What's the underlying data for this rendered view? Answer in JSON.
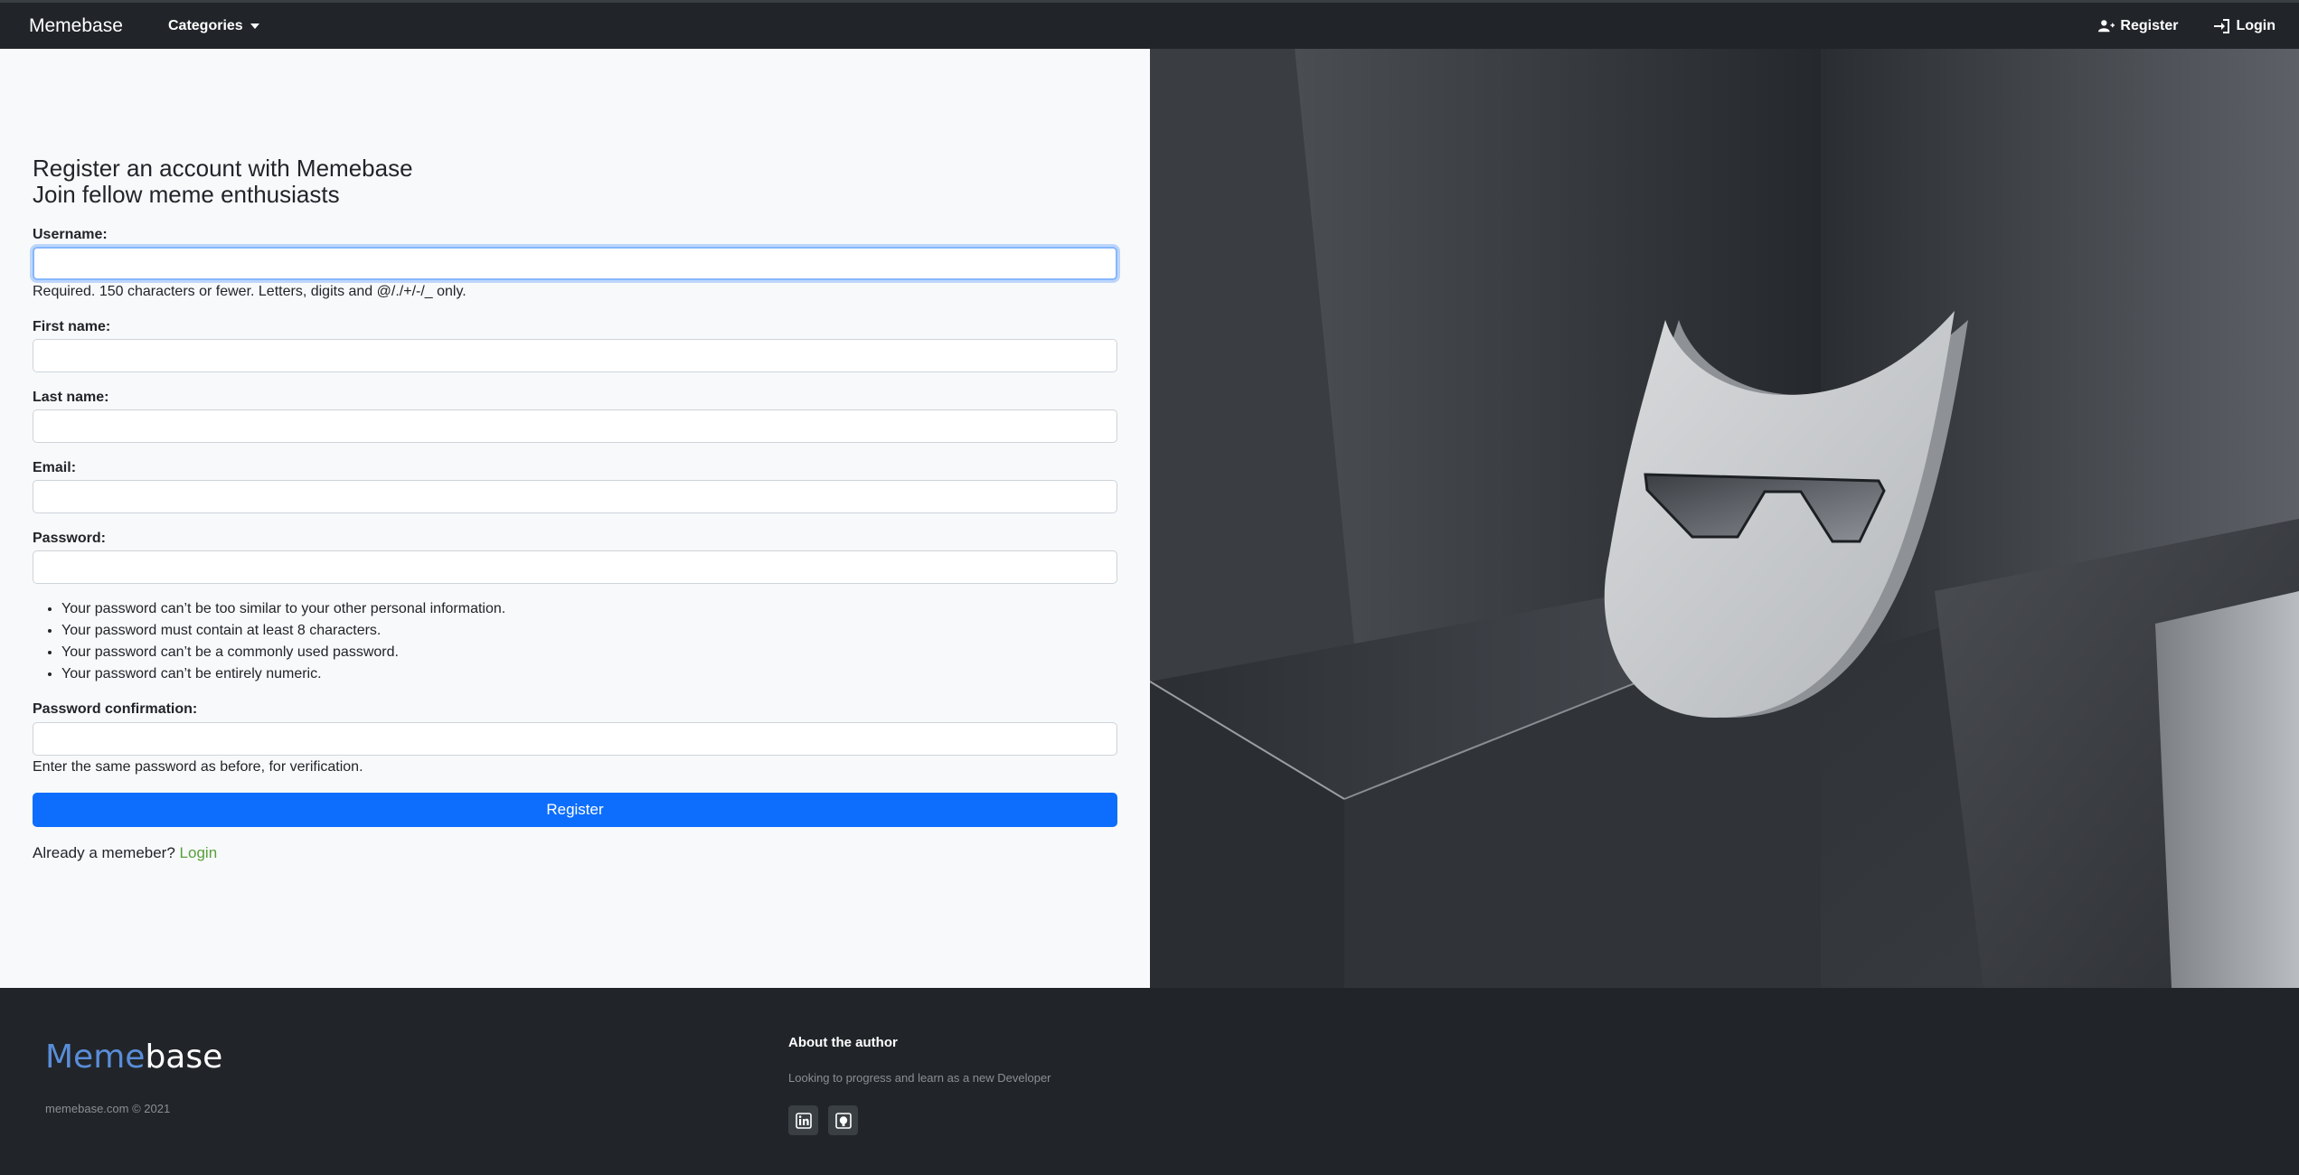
{
  "nav": {
    "brand": "Memebase",
    "categories_label": "Categories",
    "register_label": "Register",
    "login_label": "Login"
  },
  "form": {
    "heading_line1": "Register an account with Memebase",
    "heading_line2": "Join fellow meme enthusiasts",
    "username_label": "Username:",
    "username_help": "Required. 150 characters or fewer. Letters, digits and @/./+/-/_ only.",
    "first_name_label": "First name:",
    "last_name_label": "Last name:",
    "email_label": "Email:",
    "password_label": "Password:",
    "password_rules": [
      "Your password can’t be too similar to your other personal information.",
      "Your password must contain at least 8 characters.",
      "Your password can’t be a commonly used password.",
      "Your password can’t be entirely numeric."
    ],
    "password_confirm_label": "Password confirmation:",
    "password_confirm_help": "Enter the same password as before, for verification.",
    "submit_label": "Register",
    "already_text": "Already a memeber?",
    "login_link": "Login"
  },
  "footer": {
    "logo_part1": "Meme",
    "logo_part2": "base",
    "copyright": "memebase.com © 2021",
    "about_title": "About the author",
    "about_text": "Looking to progress and learn as a new Developer",
    "socials": [
      "linkedin-icon",
      "github-icon"
    ]
  },
  "colors": {
    "primary": "#0d6efd",
    "link_green": "#57a03b",
    "navbar_bg": "#212529",
    "logo_blue": "#5a8dd8"
  }
}
